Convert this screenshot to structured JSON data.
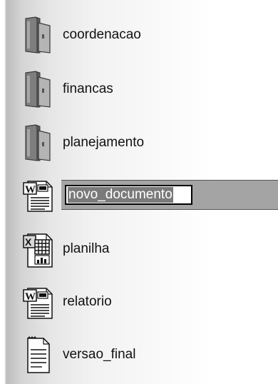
{
  "files": [
    {
      "name": "coordenacao",
      "type": "folder",
      "icon": "folder-icon"
    },
    {
      "name": "financas",
      "type": "folder",
      "icon": "folder-icon"
    },
    {
      "name": "planejamento",
      "type": "folder",
      "icon": "folder-icon"
    },
    {
      "name": "novo_documento",
      "type": "word-document",
      "icon": "word-document-icon",
      "selected": true,
      "renaming": true
    },
    {
      "name": "planilha",
      "type": "spreadsheet",
      "icon": "spreadsheet-icon"
    },
    {
      "name": "relatorio",
      "type": "word-document",
      "icon": "word-document-icon"
    },
    {
      "name": "versao_final",
      "type": "text-document",
      "icon": "text-document-icon"
    }
  ],
  "rename": {
    "value": "novo_documento"
  },
  "colors": {
    "selection_bar": "#a4a4a4",
    "selected_text_bg": "#7a7a7a",
    "folder": "#8c8c8c"
  }
}
